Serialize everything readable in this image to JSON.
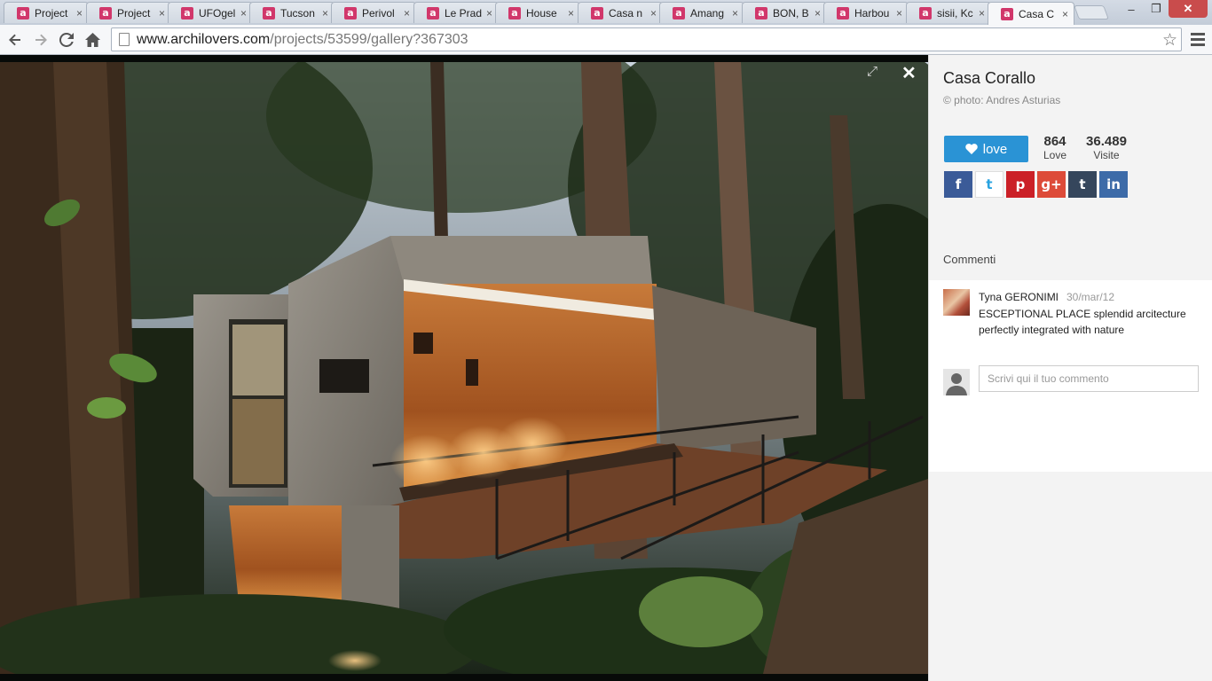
{
  "tabs": [
    {
      "label": "Project",
      "active": false
    },
    {
      "label": "Project",
      "active": false
    },
    {
      "label": "UFOgel",
      "active": false
    },
    {
      "label": "Tucson",
      "active": false
    },
    {
      "label": "Perivol",
      "active": false
    },
    {
      "label": "Le Prad",
      "active": false
    },
    {
      "label": "House",
      "active": false
    },
    {
      "label": "Casa n",
      "active": false
    },
    {
      "label": "Amang",
      "active": false
    },
    {
      "label": "BON, B",
      "active": false
    },
    {
      "label": "Harbou",
      "active": false
    },
    {
      "label": "sisii, Kc",
      "active": false
    },
    {
      "label": "Casa C",
      "active": true
    }
  ],
  "favicon_letter": "a",
  "tab_close_glyph": "×",
  "window": {
    "minimize": "–",
    "maximize": "❐",
    "close": "✕"
  },
  "toolbar": {
    "back": "back-arrow-icon",
    "forward": "forward-arrow-icon",
    "reload": "reload-icon",
    "home": "home-icon",
    "url_domain": "www.archilovers.com",
    "url_path": "/projects/53599/gallery?367303"
  },
  "viewer": {
    "close_glyph": "✕",
    "fullscreen_glyph": "⤢"
  },
  "panel": {
    "title": "Casa Corallo",
    "credit": "© photo: Andres Asturias",
    "love_label": "love",
    "stats": [
      {
        "value": "864",
        "label": "Love"
      },
      {
        "value": "36.489",
        "label": "Visite"
      }
    ],
    "social": [
      {
        "name": "facebook",
        "glyph": "f"
      },
      {
        "name": "twitter",
        "glyph": "t"
      },
      {
        "name": "pinterest",
        "glyph": "p"
      },
      {
        "name": "google-plus",
        "glyph": "g+"
      },
      {
        "name": "tumblr",
        "glyph": "t"
      },
      {
        "name": "linkedin",
        "glyph": "in"
      }
    ],
    "comments_title": "Commenti",
    "comment": {
      "author": "Tyna GERONIMI",
      "date": "30/mar/12",
      "text": "ESCEPTIONAL PLACE splendid arcitecture perfectly integrated with nature"
    },
    "comment_placeholder": "Scrivi qui il tuo commento"
  },
  "colors": {
    "accent": "#2a93d5",
    "favicon": "#d1376b",
    "panel_bg": "#f3f3f3",
    "viewer_bg": "#070a08"
  }
}
